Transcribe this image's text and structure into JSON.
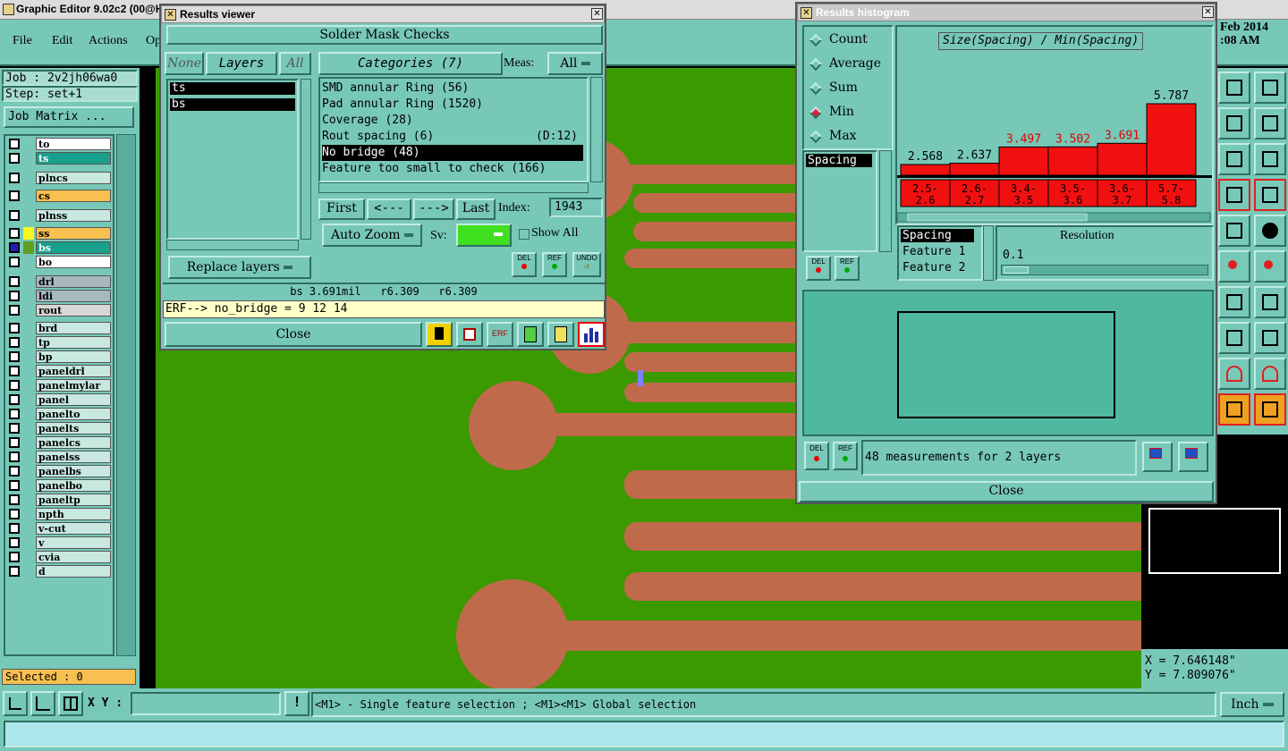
{
  "app": {
    "title": "Graphic Editor 9.02c2 (00@H",
    "clock_date": "Feb 2014",
    "clock_time": ":08 AM"
  },
  "menu": {
    "file": "File",
    "edit": "Edit",
    "actions": "Actions",
    "options": "Op"
  },
  "job": {
    "job_label": "Job : 2v2jh06wa0",
    "step_label": "Step: set+1",
    "matrix_button": "Job Matrix ..."
  },
  "layers": [
    {
      "name": "to",
      "color": "#ffffff"
    },
    {
      "name": "ts",
      "color": "#18a08c"
    },
    {
      "name": "plncs",
      "color": "#c8e8e0"
    },
    {
      "name": "cs",
      "color": "#f8c050"
    },
    {
      "name": "plnss",
      "color": "#c8e8e0"
    },
    {
      "name": "ss",
      "color": "#f8c050"
    },
    {
      "name": "bs",
      "color": "#18a08c"
    },
    {
      "name": "bo",
      "color": "#ffffff"
    },
    {
      "name": "drl",
      "color": "#a8b8c0"
    },
    {
      "name": "ldi",
      "color": "#a8b8c0"
    },
    {
      "name": "rout",
      "color": "#d8d8d8"
    },
    {
      "name": "brd",
      "color": "#c8e8e0"
    },
    {
      "name": "tp",
      "color": "#c8e8e0"
    },
    {
      "name": "bp",
      "color": "#c8e8e0"
    },
    {
      "name": "paneldrl",
      "color": "#c8e8e0"
    },
    {
      "name": "panelmylar",
      "color": "#c8e8e0"
    },
    {
      "name": "panel",
      "color": "#c8e8e0"
    },
    {
      "name": "panelto",
      "color": "#c8e8e0"
    },
    {
      "name": "panelts",
      "color": "#c8e8e0"
    },
    {
      "name": "panelcs",
      "color": "#c8e8e0"
    },
    {
      "name": "panelss",
      "color": "#c8e8e0"
    },
    {
      "name": "panelbs",
      "color": "#c8e8e0"
    },
    {
      "name": "panelbo",
      "color": "#c8e8e0"
    },
    {
      "name": "paneltp",
      "color": "#c8e8e0"
    },
    {
      "name": "npth",
      "color": "#c8e8e0"
    },
    {
      "name": "v-cut",
      "color": "#c8e8e0"
    },
    {
      "name": "v",
      "color": "#c8e8e0"
    },
    {
      "name": "cvia",
      "color": "#c8e8e0"
    },
    {
      "name": "d",
      "color": "#c8e8e0"
    }
  ],
  "selected": "Selected : 0",
  "results_viewer": {
    "title": "Results viewer",
    "header": "Solder Mask Checks",
    "none": "None",
    "layers": "Layers",
    "all": "All",
    "layer_list": [
      "ts",
      "bs"
    ],
    "categories_button": "Categories (7)",
    "meas_label": "Meas:",
    "meas_value": "All",
    "categories": [
      {
        "name": "SMD annular Ring (56)",
        "extra": "",
        "selected": false
      },
      {
        "name": "Pad annular Ring (1520)",
        "extra": "",
        "selected": false
      },
      {
        "name": "Coverage (28)",
        "extra": "",
        "selected": false
      },
      {
        "name": "Rout spacing (6)",
        "extra": "(D:12)",
        "selected": false
      },
      {
        "name": "No bridge (48)",
        "extra": "",
        "selected": true
      },
      {
        "name": "Feature too small to check (166)",
        "extra": "",
        "selected": false
      }
    ],
    "first": "First",
    "prev": "<---",
    "next": "--->",
    "last": "Last",
    "index_label": "Index:",
    "index_value": "1943",
    "auto_zoom": "Auto Zoom",
    "sv_label": "Sv:",
    "show_all": "Show All",
    "replace_layers": "Replace layers",
    "del": "DEL",
    "ref": "REF",
    "undo": "UNDO",
    "status_line": "bs 3.691mil   r6.309   r6.309",
    "erf_line": "ERF--> no_bridge = 9 12 14",
    "close": "Close",
    "erf_icon": "ERF"
  },
  "histogram": {
    "title": "Results histogram",
    "modes": [
      {
        "label": "Count",
        "selected": false
      },
      {
        "label": "Average",
        "selected": false
      },
      {
        "label": "Sum",
        "selected": false
      },
      {
        "label": "Min",
        "selected": true
      },
      {
        "label": "Max",
        "selected": false
      }
    ],
    "measure_list": [
      "Spacing"
    ],
    "chart_title": "Size(Spacing) / Min(Spacing)",
    "field_list": [
      "Spacing",
      "Feature 1",
      "Feature 2"
    ],
    "resolution_label": "Resolution",
    "resolution_value": "0.1",
    "measurements_text": "48 measurements for 2 layers",
    "close": "Close",
    "del": "DEL",
    "ref": "REF"
  },
  "chart_data": {
    "type": "bar",
    "title": "Size(Spacing) / Min(Spacing)",
    "categories": [
      "2.5-2.6",
      "2.6-2.7",
      "3.4-3.5",
      "3.5-3.6",
      "3.6-3.7",
      "5.7-5.8"
    ],
    "category_top": [
      "2.5-",
      "2.6-",
      "3.4-",
      "3.5-",
      "3.6-",
      "5.7-"
    ],
    "category_bottom": [
      "2.6",
      "2.7",
      "3.5",
      "3.6",
      "3.7",
      "5.8"
    ],
    "values": [
      2.568,
      2.637,
      3.497,
      3.502,
      3.691,
      5.787
    ],
    "value_labels": [
      "2.568",
      "2.637",
      "3.497",
      "3.502",
      "3.691",
      "5.787"
    ],
    "label_colors": [
      "#000000",
      "#000000",
      "#e00000",
      "#e00000",
      "#e00000",
      "#000000"
    ],
    "bar_color": "#f01010",
    "ylim": [
      0,
      5.787
    ]
  },
  "coords": {
    "x": "X = 7.646148\"",
    "y": "Y = 7.809076\""
  },
  "bottom": {
    "xy_label": "X Y :",
    "xy_value": "",
    "hint": "<M1> - Single feature selection ; <M1><M1> Global selection",
    "units": "Inch",
    "exclaim": "!"
  },
  "right_tools": [
    "home-icon",
    "window-icon",
    "snap-icon",
    "s-route-icon",
    "scale-icon",
    "help-icon",
    "drc-icon",
    "drc2-icon",
    "ruler-icon",
    "dot-icon",
    "move-icon",
    "move2-icon",
    "undo-icon",
    "split-icon",
    "measure-icon",
    "group-icon",
    "pad-a-icon",
    "pad-b-icon",
    "pointer-icon",
    "pointer2-icon"
  ],
  "colors": {
    "board_green": "#3a9a00",
    "copper": "#c06a4c",
    "panel_teal": "#78c8b8"
  }
}
